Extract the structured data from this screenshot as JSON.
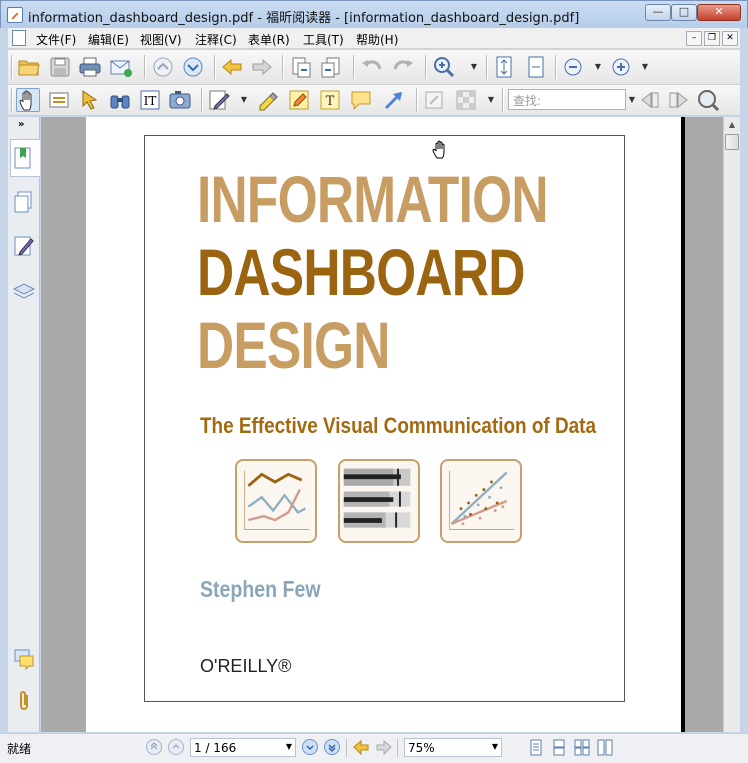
{
  "window": {
    "title": "information_dashboard_design.pdf - 福昕阅读器 - [information_dashboard_design.pdf]",
    "minimize_label": "—",
    "maximize_label": "□",
    "close_label": "✕"
  },
  "menu": {
    "items": [
      "文件(F)",
      "编辑(E)",
      "视图(V)",
      "注释(C)",
      "表单(R)",
      "工具(T)",
      "帮助(H)"
    ],
    "mdi_min": "–",
    "mdi_restore": "❐",
    "mdi_close": "✕"
  },
  "toolbar": {
    "find_placeholder": "查找:"
  },
  "leftpanel": {
    "collapse_label": "»"
  },
  "document": {
    "title_line1": "INFORMATION",
    "title_line2": "DASHBOARD",
    "title_line3": "DESIGN",
    "subtitle": "The Effective Visual Communication of Data",
    "author": "Stephen Few",
    "publisher": "O'REILLY®",
    "colors": {
      "title_light": "#c89d63",
      "title_dark": "#9b6410",
      "subtitle": "#a36a12",
      "author": "#8ba6b8"
    }
  },
  "status": {
    "text": "就绪",
    "page_indicator": "1 / 166",
    "zoom": "75%"
  }
}
